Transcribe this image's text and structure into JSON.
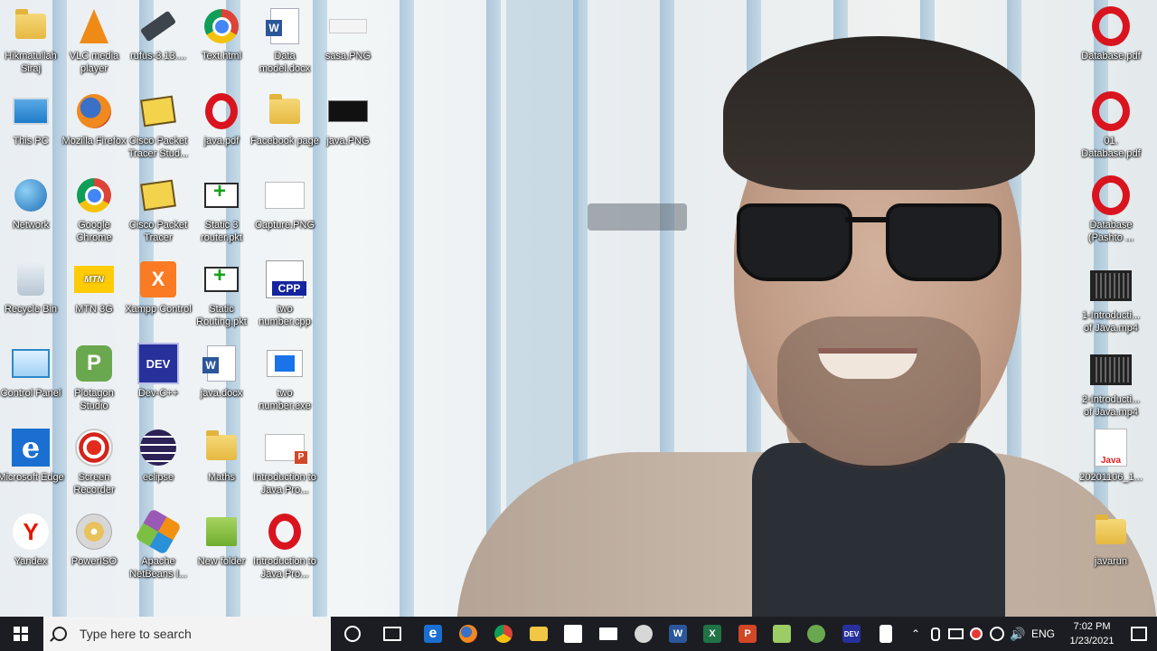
{
  "desktop": {
    "icons": [
      {
        "label": "Hikmatullah Siraj",
        "icon": "user-folder-icon"
      },
      {
        "label": "VLC media player",
        "icon": "vlc-icon"
      },
      {
        "label": "rufus-3.13....",
        "icon": "usb-drive-icon"
      },
      {
        "label": "Text.html",
        "icon": "chrome-icon"
      },
      {
        "label": "Data model.docx",
        "icon": "word-doc-icon"
      },
      {
        "label": "sasa.PNG",
        "icon": "image-thumbnail-icon"
      },
      {
        "label": "This PC",
        "icon": "computer-icon"
      },
      {
        "label": "Mozilla Firefox",
        "icon": "firefox-icon"
      },
      {
        "label": "Cisco Packet Tracer Stud...",
        "icon": "packet-tracer-icon"
      },
      {
        "label": "java.pdf",
        "icon": "opera-pdf-icon"
      },
      {
        "label": "Facebook page",
        "icon": "folder-icon"
      },
      {
        "label": "java.PNG",
        "icon": "image-thumbnail-icon"
      },
      {
        "label": "Network",
        "icon": "network-globe-icon"
      },
      {
        "label": "Google Chrome",
        "icon": "chrome-icon"
      },
      {
        "label": "Cisco Packet Tracer",
        "icon": "packet-tracer-icon"
      },
      {
        "label": "Static 3 router.pkt",
        "icon": "pkt-file-icon"
      },
      {
        "label": "Capture.PNG",
        "icon": "image-thumbnail-icon"
      },
      {
        "label": "Recycle Bin",
        "icon": "recycle-bin-icon"
      },
      {
        "label": "MTN 3G",
        "icon": "mtn-icon"
      },
      {
        "label": "Xampp Control",
        "icon": "xampp-icon"
      },
      {
        "label": "Static Routing.pkt",
        "icon": "pkt-file-icon"
      },
      {
        "label": "two number.cpp",
        "icon": "cpp-file-icon"
      },
      {
        "label": "Control Panel",
        "icon": "control-panel-icon"
      },
      {
        "label": "Plotagon Studio",
        "icon": "plotagon-icon"
      },
      {
        "label": "Dev-C++",
        "icon": "devcpp-icon"
      },
      {
        "label": "java.docx",
        "icon": "word-doc-icon"
      },
      {
        "label": "two number.exe",
        "icon": "exe-file-icon"
      },
      {
        "label": "Microsoft Edge",
        "icon": "edge-icon"
      },
      {
        "label": "Screen Recorder",
        "icon": "screen-recorder-icon"
      },
      {
        "label": "eclipse",
        "icon": "eclipse-icon"
      },
      {
        "label": "Maths",
        "icon": "folder-icon"
      },
      {
        "label": "Introduction to Java Pro...",
        "icon": "pptx-file-icon"
      },
      {
        "label": "Yandex",
        "icon": "yandex-icon"
      },
      {
        "label": "PowerISO",
        "icon": "poweriso-icon"
      },
      {
        "label": "Apache NetBeans I...",
        "icon": "netbeans-icon"
      },
      {
        "label": "New folder",
        "icon": "folder-icon"
      },
      {
        "label": "Introduction to Java Pro...",
        "icon": "opera-pdf-icon"
      }
    ],
    "right_icons": [
      {
        "label": "Database.pdf",
        "icon": "opera-pdf-icon"
      },
      {
        "label": "01. Database.pdf",
        "icon": "opera-pdf-icon"
      },
      {
        "label": "Database (Pashto ...",
        "icon": "opera-pdf-icon"
      },
      {
        "label": "1-Introducti... of Java.mp4",
        "icon": "video-file-icon"
      },
      {
        "label": "2-Introducti... of Java.mp4",
        "icon": "video-file-icon"
      },
      {
        "label": "20201106_1...",
        "icon": "java-file-icon"
      },
      {
        "label": "javarun",
        "icon": "folder-icon"
      }
    ]
  },
  "taskbar": {
    "search_placeholder": "Type here to search",
    "pinned": [
      {
        "name": "cortana",
        "icon": "cortana-circle-icon"
      },
      {
        "name": "task-view",
        "icon": "task-view-icon"
      },
      {
        "name": "edge",
        "icon": "edge-icon"
      },
      {
        "name": "firefox",
        "icon": "firefox-icon"
      },
      {
        "name": "chrome",
        "icon": "chrome-icon"
      },
      {
        "name": "file-explorer",
        "icon": "file-explorer-icon"
      },
      {
        "name": "store",
        "icon": "store-icon"
      },
      {
        "name": "mail",
        "icon": "mail-icon"
      },
      {
        "name": "packet-tracer",
        "icon": "packet-tracer-icon"
      },
      {
        "name": "word",
        "icon": "word-icon"
      },
      {
        "name": "excel",
        "icon": "excel-icon"
      },
      {
        "name": "powerpoint",
        "icon": "powerpoint-icon"
      },
      {
        "name": "notepad-plus",
        "icon": "notepad-icon"
      },
      {
        "name": "packet-tracer-2",
        "icon": "packet-tracer-icon"
      },
      {
        "name": "dev-cpp",
        "icon": "devcpp-icon"
      },
      {
        "name": "blank-file",
        "icon": "file-icon"
      }
    ],
    "tray": {
      "language": "ENG",
      "time": "7:02 PM",
      "date": "1/23/2021"
    }
  }
}
